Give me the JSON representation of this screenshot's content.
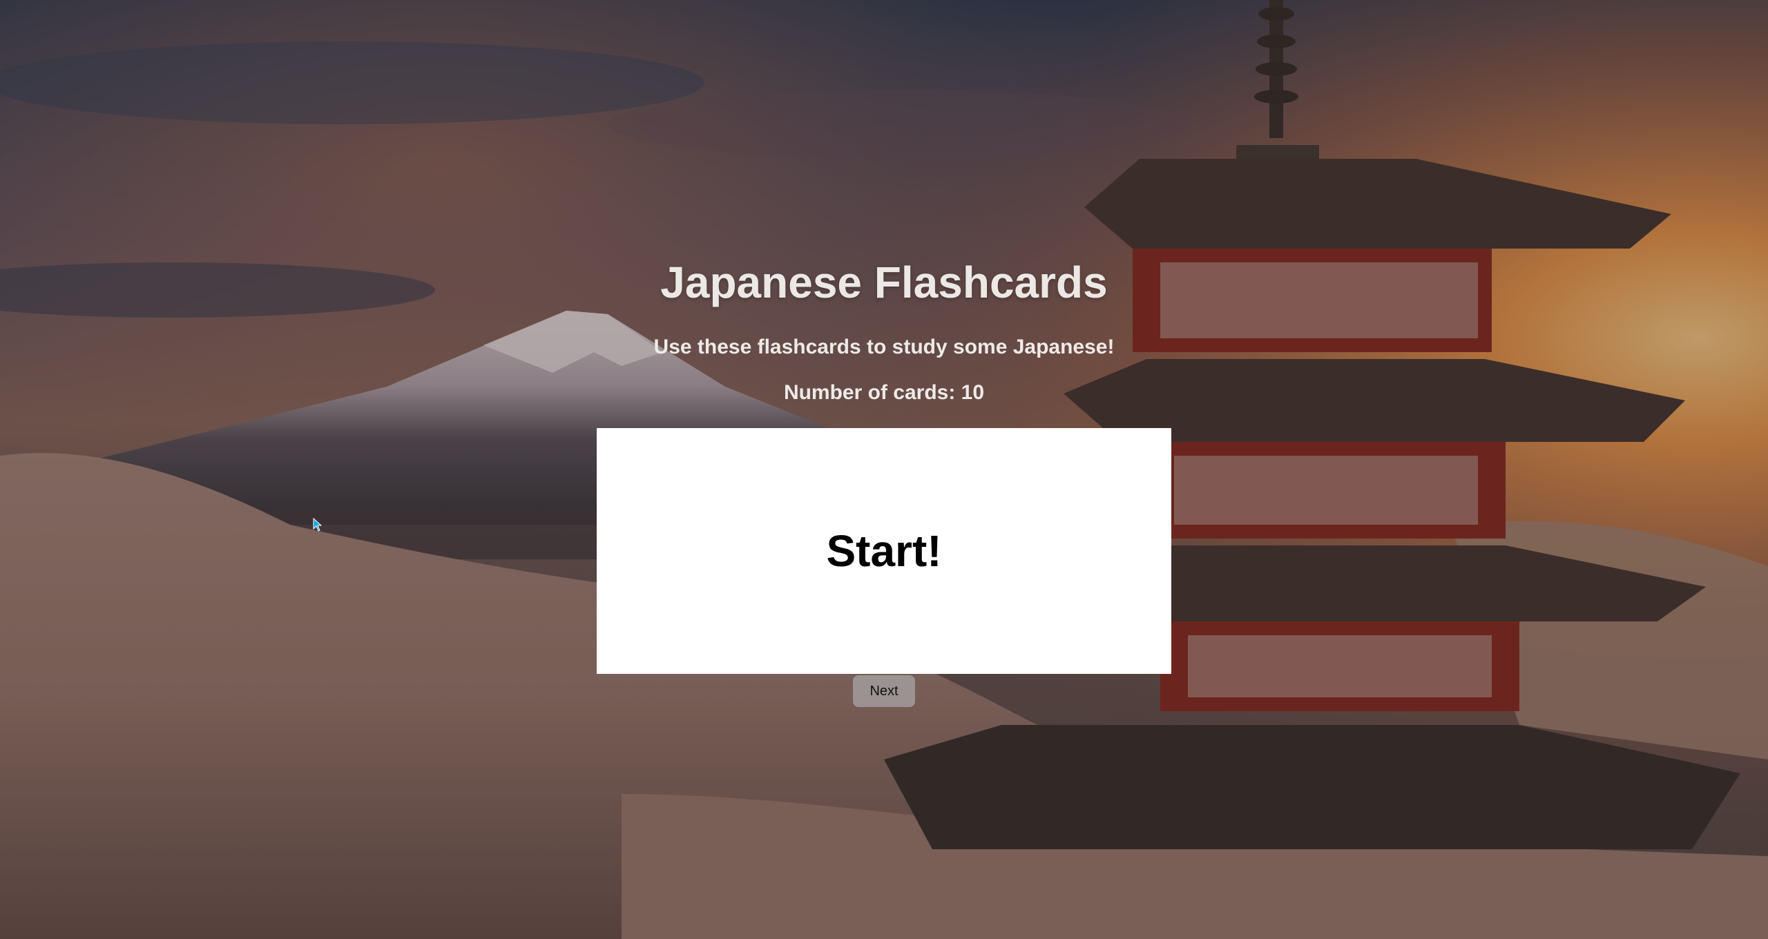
{
  "header": {
    "title": "Japanese Flashcards",
    "subtitle": "Use these flashcards to study some Japanese!",
    "card_count_label": "Number of cards:",
    "card_count": 10
  },
  "card": {
    "text": "Start!"
  },
  "controls": {
    "next_label": "Next"
  },
  "background": {
    "description_icon": "mount-fuji-pagoda-sunset-background",
    "sky_color": "#3c5170",
    "sunset_color": "#e0874a",
    "blossom_color": "#b98f80",
    "pagoda_roof_color": "#4a3a36",
    "pagoda_wall_color": "#8c2e26"
  },
  "colors": {
    "card_bg": "#ffffff",
    "button_bg": "#9a9391",
    "title_text": "#ece8e6"
  }
}
